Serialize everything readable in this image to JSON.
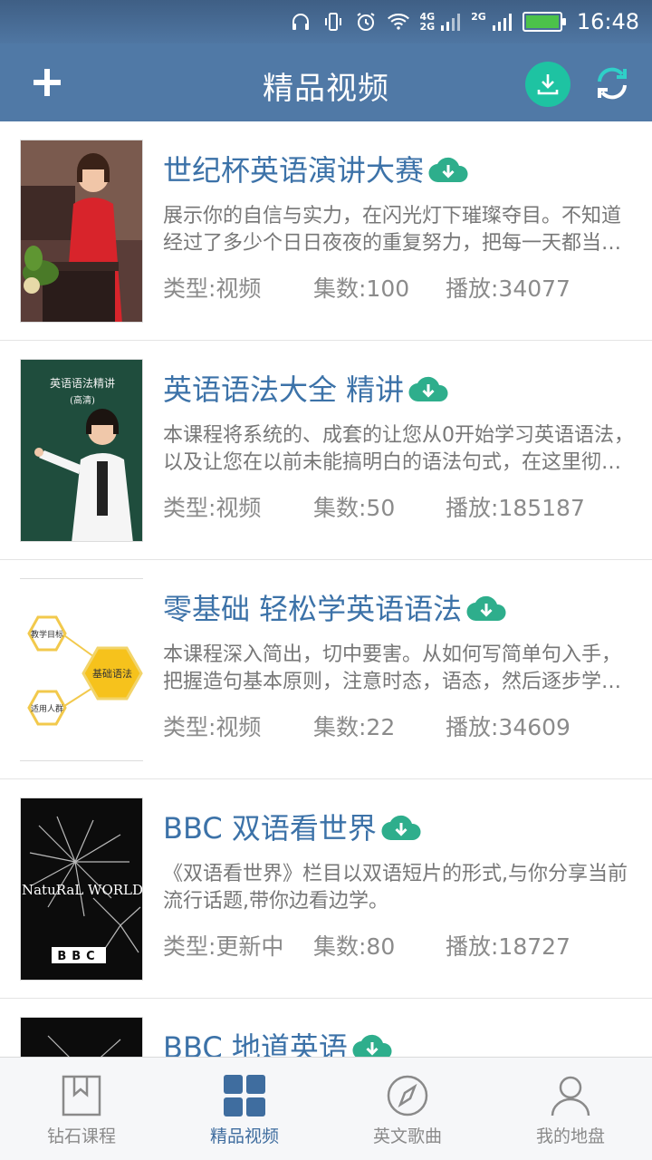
{
  "status_bar": {
    "network_top": "4G",
    "network_bottom": "2G",
    "network2": "2G",
    "time": "16:48"
  },
  "header": {
    "title": "精品视频",
    "icons": [
      "plus-icon",
      "download-icon",
      "refresh-icon"
    ]
  },
  "courses": [
    {
      "title": "世纪杯英语演讲大赛",
      "description": "展示你的自信与实力，在闪光灯下璀璨夺目。不知道经过了多少个日日夜夜的重复努力，把每一天都当作最后一天来珍惜。",
      "type": "类型:视频",
      "count": "集数:100",
      "plays": "播放:34077"
    },
    {
      "title": "英语语法大全 精讲",
      "description": "本课程将系统的、成套的让您从0开始学习英语语法，以及让您在以前未能搞明白的语法句式，在这里彻底弄懂。",
      "type": "类型:视频",
      "count": "集数:50",
      "plays": "播放:185187",
      "thumb_text_1": "英语语法精讲",
      "thumb_text_2": "(高清)"
    },
    {
      "title": "零基础 轻松学英语语法",
      "description": "本课程深入简出，切中要害。从如何写简单句入手，把握造句基本原则，注意时态，语态，然后逐步学习复杂句型。",
      "type": "类型:视频",
      "count": "集数:22",
      "plays": "播放:34609",
      "thumb_text_1": "教学目标",
      "thumb_text_2": "基础语法",
      "thumb_text_3": "适用人群"
    },
    {
      "title": "BBC 双语看世界",
      "description": "《双语看世界》栏目以双语短片的形式,与你分享当前流行话题,带你边看边学。",
      "type": "类型:更新中",
      "count": "集数:80",
      "plays": "播放:18727",
      "thumb_text_1": "NatuRaL WORLD",
      "thumb_text_2": "BBC"
    },
    {
      "title": "BBC 地道英语"
    }
  ],
  "bottom_nav": [
    {
      "label": "钻石课程",
      "icon": "bookmark-book-icon"
    },
    {
      "label": "精品视频",
      "icon": "grid-icon"
    },
    {
      "label": "英文歌曲",
      "icon": "compass-icon"
    },
    {
      "label": "我的地盘",
      "icon": "user-icon"
    }
  ],
  "colors": {
    "header": "#5079a6",
    "accent_green": "#1ec3a2",
    "title_blue": "#3c72a8",
    "nav_active": "#3f6d9f"
  }
}
